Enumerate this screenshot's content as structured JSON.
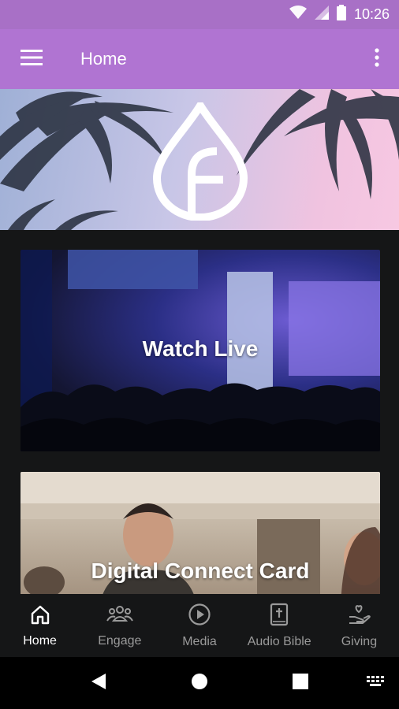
{
  "status_bar": {
    "time": "10:26"
  },
  "app_bar": {
    "title": "Home"
  },
  "cards": {
    "watch_live": "Watch Live",
    "connect_card": "Digital Connect Card"
  },
  "bottom_nav": {
    "items": [
      {
        "label": "Home",
        "icon": "home-icon",
        "active": true
      },
      {
        "label": "Engage",
        "icon": "people-icon",
        "active": false
      },
      {
        "label": "Media",
        "icon": "play-circle-icon",
        "active": false
      },
      {
        "label": "Audio Bible",
        "icon": "bible-icon",
        "active": false
      },
      {
        "label": "Giving",
        "icon": "giving-hand-icon",
        "active": false
      }
    ]
  },
  "colors": {
    "status_bar": "#a870c6",
    "app_bar": "#b074d2",
    "background": "#151617",
    "nav_active": "#ffffff",
    "nav_inactive": "#9a9a9a"
  }
}
